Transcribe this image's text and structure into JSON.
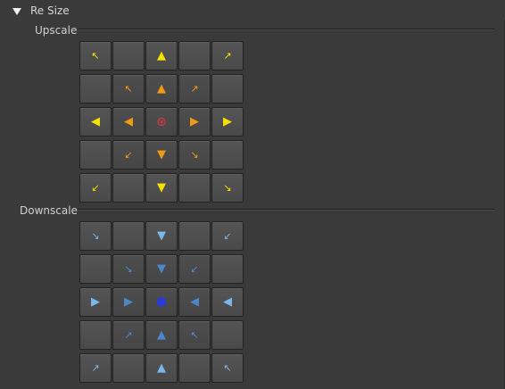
{
  "header": {
    "title": "Re Size"
  },
  "sections": [
    {
      "label": "Upscale",
      "rows": [
        [
          {
            "g": "↖",
            "c": "y",
            "s": "sm",
            "i": "arrow-up-left-icon"
          },
          {
            "g": "",
            "c": "",
            "s": "",
            "i": ""
          },
          {
            "g": "▲",
            "c": "y",
            "s": "md",
            "i": "arrow-up-icon"
          },
          {
            "g": "",
            "c": "",
            "s": "",
            "i": ""
          },
          {
            "g": "↗",
            "c": "y",
            "s": "sm",
            "i": "arrow-up-right-icon"
          }
        ],
        [
          {
            "g": "",
            "c": "",
            "s": "",
            "i": ""
          },
          {
            "g": "↖",
            "c": "o",
            "s": "sm",
            "i": "arrow-up-left-icon"
          },
          {
            "g": "▲",
            "c": "o",
            "s": "md",
            "i": "arrow-up-icon"
          },
          {
            "g": "↗",
            "c": "o",
            "s": "sm",
            "i": "arrow-up-right-icon"
          },
          {
            "g": "",
            "c": "",
            "s": "",
            "i": ""
          }
        ],
        [
          {
            "g": "◀",
            "c": "y",
            "s": "md",
            "i": "arrow-left-icon"
          },
          {
            "g": "◀",
            "c": "o",
            "s": "md",
            "i": "arrow-left-icon"
          },
          {
            "g": "⊛",
            "c": "r",
            "s": "",
            "i": "center-target-icon"
          },
          {
            "g": "▶",
            "c": "o",
            "s": "md",
            "i": "arrow-right-icon"
          },
          {
            "g": "▶",
            "c": "y",
            "s": "md",
            "i": "arrow-right-icon"
          }
        ],
        [
          {
            "g": "",
            "c": "",
            "s": "",
            "i": ""
          },
          {
            "g": "↙",
            "c": "o",
            "s": "sm",
            "i": "arrow-down-left-icon"
          },
          {
            "g": "▼",
            "c": "o",
            "s": "md",
            "i": "arrow-down-icon"
          },
          {
            "g": "↘",
            "c": "o",
            "s": "sm",
            "i": "arrow-down-right-icon"
          },
          {
            "g": "",
            "c": "",
            "s": "",
            "i": ""
          }
        ],
        [
          {
            "g": "↙",
            "c": "y",
            "s": "sm",
            "i": "arrow-down-left-icon"
          },
          {
            "g": "",
            "c": "",
            "s": "",
            "i": ""
          },
          {
            "g": "▼",
            "c": "y",
            "s": "md",
            "i": "arrow-down-icon"
          },
          {
            "g": "",
            "c": "",
            "s": "",
            "i": ""
          },
          {
            "g": "↘",
            "c": "y",
            "s": "sm",
            "i": "arrow-down-right-icon"
          }
        ]
      ]
    },
    {
      "label": "Downscale",
      "rows": [
        [
          {
            "g": "↘",
            "c": "b",
            "s": "sm",
            "i": "arrow-down-right-icon"
          },
          {
            "g": "",
            "c": "",
            "s": "",
            "i": ""
          },
          {
            "g": "▼",
            "c": "b",
            "s": "md",
            "i": "arrow-down-icon"
          },
          {
            "g": "",
            "c": "",
            "s": "",
            "i": ""
          },
          {
            "g": "↙",
            "c": "b",
            "s": "sm",
            "i": "arrow-down-left-icon"
          }
        ],
        [
          {
            "g": "",
            "c": "",
            "s": "",
            "i": ""
          },
          {
            "g": "↘",
            "c": "b2",
            "s": "sm",
            "i": "arrow-down-right-icon"
          },
          {
            "g": "▼",
            "c": "b2",
            "s": "md",
            "i": "arrow-down-icon"
          },
          {
            "g": "↙",
            "c": "b2",
            "s": "sm",
            "i": "arrow-down-left-icon"
          },
          {
            "g": "",
            "c": "",
            "s": "",
            "i": ""
          }
        ],
        [
          {
            "g": "▶",
            "c": "b",
            "s": "md",
            "i": "arrow-right-icon"
          },
          {
            "g": "▶",
            "c": "b2",
            "s": "md",
            "i": "arrow-right-icon"
          },
          {
            "g": "⬢",
            "c": "nb",
            "s": "",
            "i": "center-target-icon"
          },
          {
            "g": "◀",
            "c": "b2",
            "s": "md",
            "i": "arrow-left-icon"
          },
          {
            "g": "◀",
            "c": "b",
            "s": "md",
            "i": "arrow-left-icon"
          }
        ],
        [
          {
            "g": "",
            "c": "",
            "s": "",
            "i": ""
          },
          {
            "g": "↗",
            "c": "b2",
            "s": "sm",
            "i": "arrow-up-right-icon"
          },
          {
            "g": "▲",
            "c": "b2",
            "s": "md",
            "i": "arrow-up-icon"
          },
          {
            "g": "↖",
            "c": "b2",
            "s": "sm",
            "i": "arrow-up-left-icon"
          },
          {
            "g": "",
            "c": "",
            "s": "",
            "i": ""
          }
        ],
        [
          {
            "g": "↗",
            "c": "b",
            "s": "sm",
            "i": "arrow-up-right-icon"
          },
          {
            "g": "",
            "c": "",
            "s": "",
            "i": ""
          },
          {
            "g": "▲",
            "c": "b",
            "s": "md",
            "i": "arrow-up-icon"
          },
          {
            "g": "",
            "c": "",
            "s": "",
            "i": ""
          },
          {
            "g": "↖",
            "c": "b",
            "s": "sm",
            "i": "arrow-up-left-icon"
          }
        ]
      ]
    }
  ],
  "colors": {
    "upscale_outer": "#f5e100",
    "upscale_inner": "#f19a12",
    "upscale_center": "#e03542",
    "downscale_outer": "#7ab7ea",
    "downscale_inner": "#4d87c9",
    "downscale_center": "#2a3bd6"
  }
}
